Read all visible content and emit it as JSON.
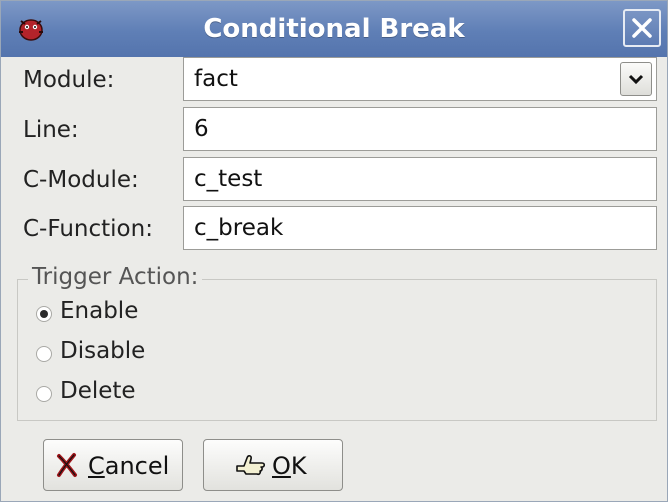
{
  "window": {
    "title": "Conditional Break",
    "app_icon": "bug-icon",
    "close_icon": "close-icon"
  },
  "form": {
    "module": {
      "label": "Module:",
      "value": "fact",
      "dropdown_icon": "chevron-down-icon"
    },
    "line": {
      "label": "Line:",
      "value": "6"
    },
    "c_module": {
      "label": "C-Module:",
      "value": "c_test"
    },
    "c_function": {
      "label": "C-Function:",
      "value": "c_break"
    }
  },
  "trigger_action": {
    "title": "Trigger Action:",
    "options": [
      {
        "label": "Enable",
        "checked": true
      },
      {
        "label": "Disable",
        "checked": false
      },
      {
        "label": "Delete",
        "checked": false
      }
    ]
  },
  "buttons": {
    "cancel": {
      "mnemonic": "C",
      "rest": "ancel",
      "icon": "cancel-x-icon"
    },
    "ok": {
      "mnemonic": "O",
      "rest": "K",
      "icon": "ok-hand-icon"
    }
  },
  "colors": {
    "titlebar": "#5f7fb6",
    "window_bg": "#ebebe8"
  }
}
